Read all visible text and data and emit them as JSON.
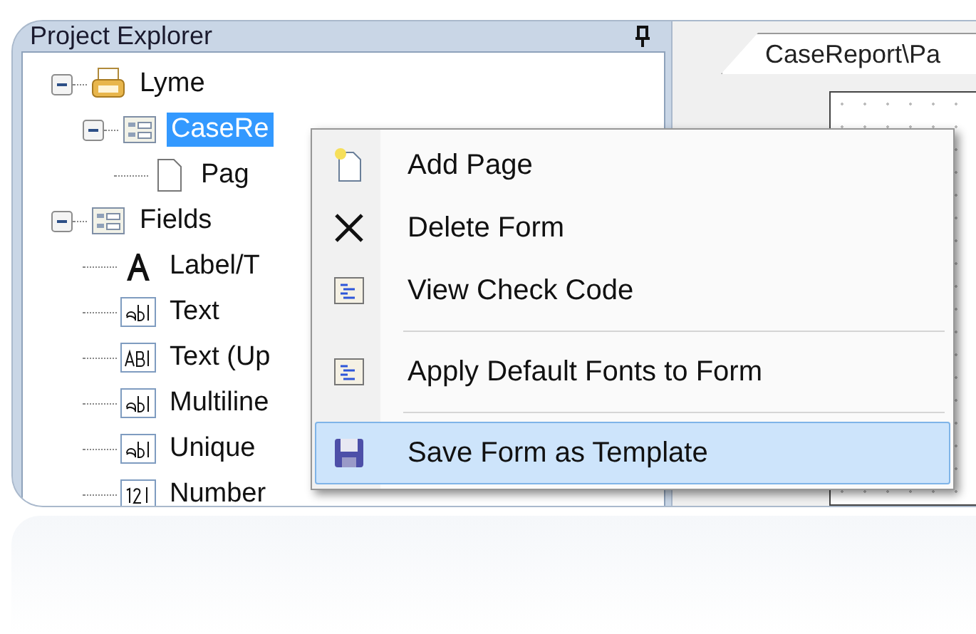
{
  "explorer": {
    "title": "Project Explorer",
    "tree": [
      {
        "label": "Lyme",
        "kind": "project",
        "expanded": true,
        "selected": false,
        "children": [
          {
            "label": "CaseRe",
            "kind": "form",
            "expanded": true,
            "selected": true,
            "children": [
              {
                "label": "Pag",
                "kind": "page",
                "selected": false
              }
            ]
          }
        ]
      },
      {
        "label": "Fields",
        "kind": "form",
        "expanded": true,
        "selected": false,
        "children": [
          {
            "label": "Label/T",
            "kind": "label",
            "selected": false
          },
          {
            "label": "Text",
            "kind": "text",
            "selected": false
          },
          {
            "label": "Text (Up",
            "kind": "upper",
            "selected": false
          },
          {
            "label": "Multiline",
            "kind": "text",
            "selected": false
          },
          {
            "label": "Unique",
            "kind": "text",
            "selected": false
          },
          {
            "label": "Number",
            "kind": "number",
            "selected": false
          }
        ]
      }
    ]
  },
  "designer": {
    "tab": "CaseReport\\Pa"
  },
  "context_menu": {
    "items": [
      {
        "kind": "item",
        "label": "Add Page",
        "selected": false
      },
      {
        "kind": "item",
        "label": "Delete Form",
        "selected": false
      },
      {
        "kind": "item",
        "label": "View Check Code",
        "selected": false
      },
      {
        "kind": "separator"
      },
      {
        "kind": "item",
        "label": "Apply Default Fonts to Form",
        "selected": false
      },
      {
        "kind": "separator"
      },
      {
        "kind": "item",
        "label": "Save Form as Template",
        "selected": true
      }
    ]
  }
}
